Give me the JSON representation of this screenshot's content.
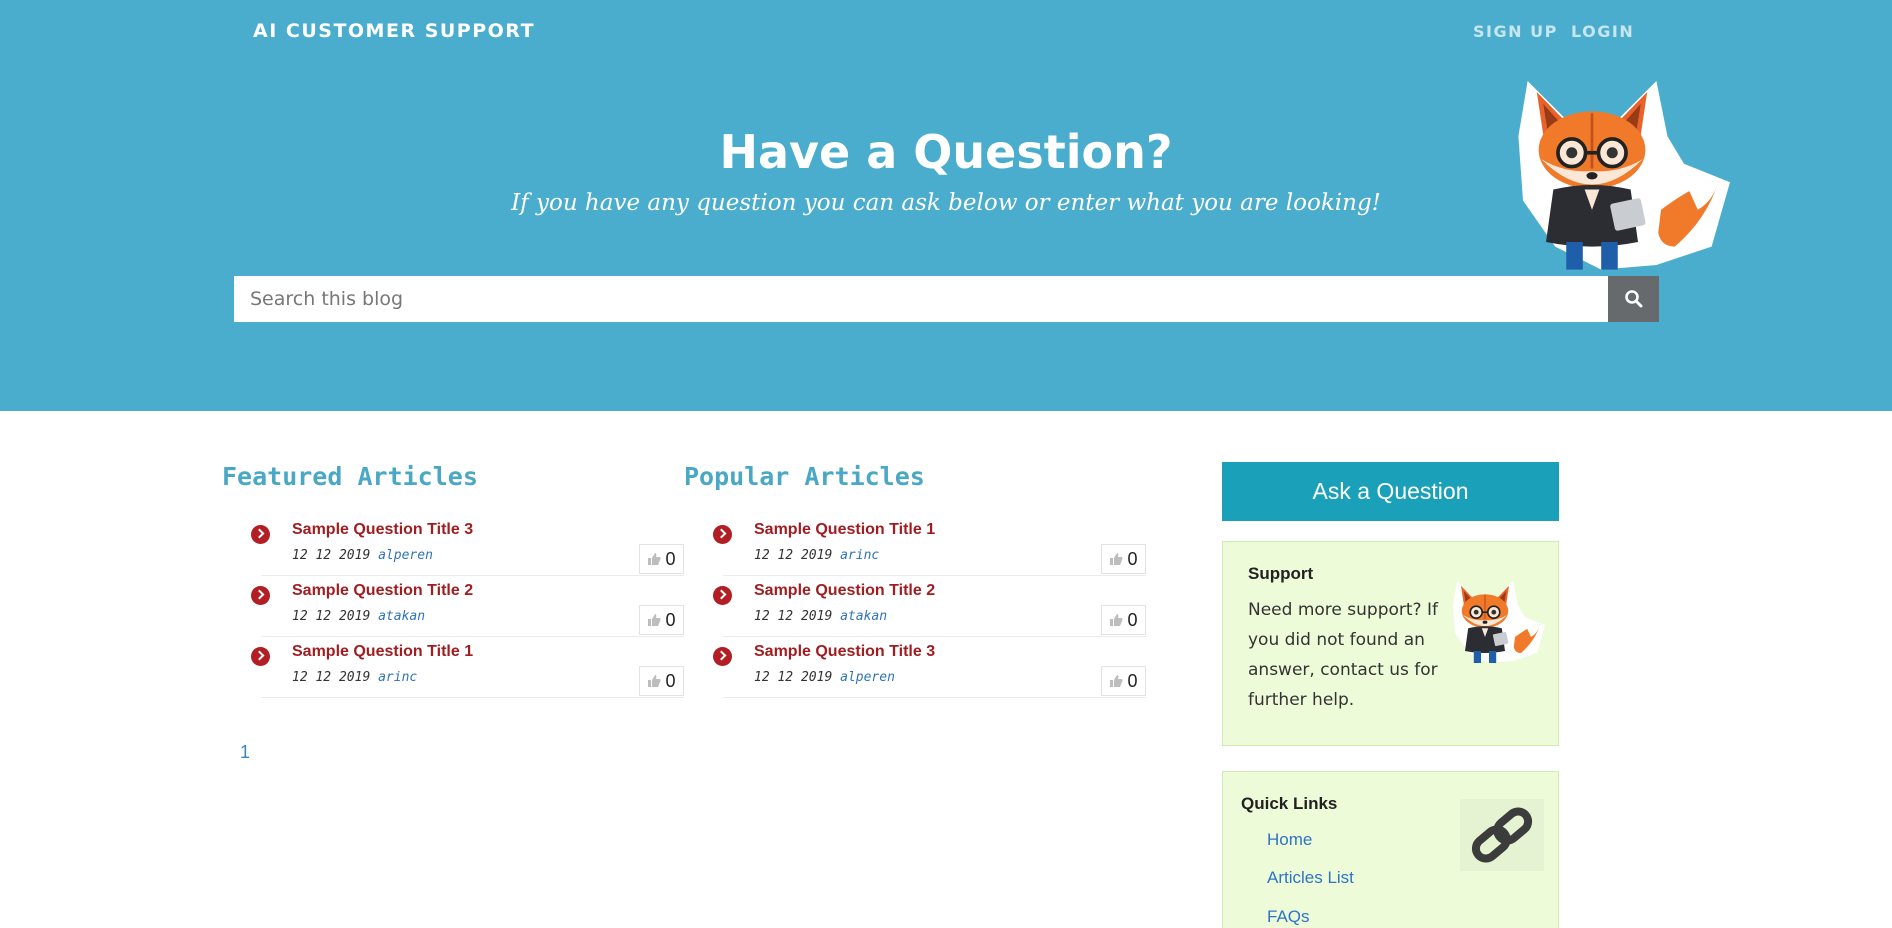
{
  "header": {
    "brand": "AI CUSTOMER SUPPORT",
    "nav": {
      "signup": "SIGN UP",
      "login": "LOGIN"
    }
  },
  "hero": {
    "title": "Have a Question?",
    "subtitle": "If you have any question you can ask below or enter what you are looking!",
    "search_placeholder": "Search this blog",
    "search_icon": "search-icon",
    "mascot_icon": "fox-mascot"
  },
  "featured": {
    "title": "Featured Articles",
    "articles": [
      {
        "title": "Sample Question Title 3",
        "date": "12 12 2019",
        "author": "alperen",
        "likes": "0"
      },
      {
        "title": "Sample Question Title 2",
        "date": "12 12 2019",
        "author": "atakan",
        "likes": "0"
      },
      {
        "title": "Sample Question Title 1",
        "date": "12 12 2019",
        "author": "arinc",
        "likes": "0"
      }
    ]
  },
  "popular": {
    "title": "Popular Articles",
    "articles": [
      {
        "title": "Sample Question Title 1",
        "date": "12 12 2019",
        "author": "arinc",
        "likes": "0"
      },
      {
        "title": "Sample Question Title 2",
        "date": "12 12 2019",
        "author": "atakan",
        "likes": "0"
      },
      {
        "title": "Sample Question Title 3",
        "date": "12 12 2019",
        "author": "alperen",
        "likes": "0"
      }
    ]
  },
  "pagination": {
    "current": "1"
  },
  "sidebar": {
    "ask_button": "Ask a Question",
    "support": {
      "title": "Support",
      "text": "Need more support? If you did not found an answer, contact us for further help."
    },
    "quick_links": {
      "title": "Quick Links",
      "links": [
        "Home",
        "Articles List",
        "FAQs"
      ]
    }
  },
  "colors": {
    "hero_bg": "#4aadcd",
    "section_title": "#4aa8c6",
    "article_title": "#a01e21",
    "bullet": "#b21e23",
    "ask_button": "#1aa1b9",
    "panel_bg": "#edfbd8",
    "link": "#2d74c4"
  }
}
